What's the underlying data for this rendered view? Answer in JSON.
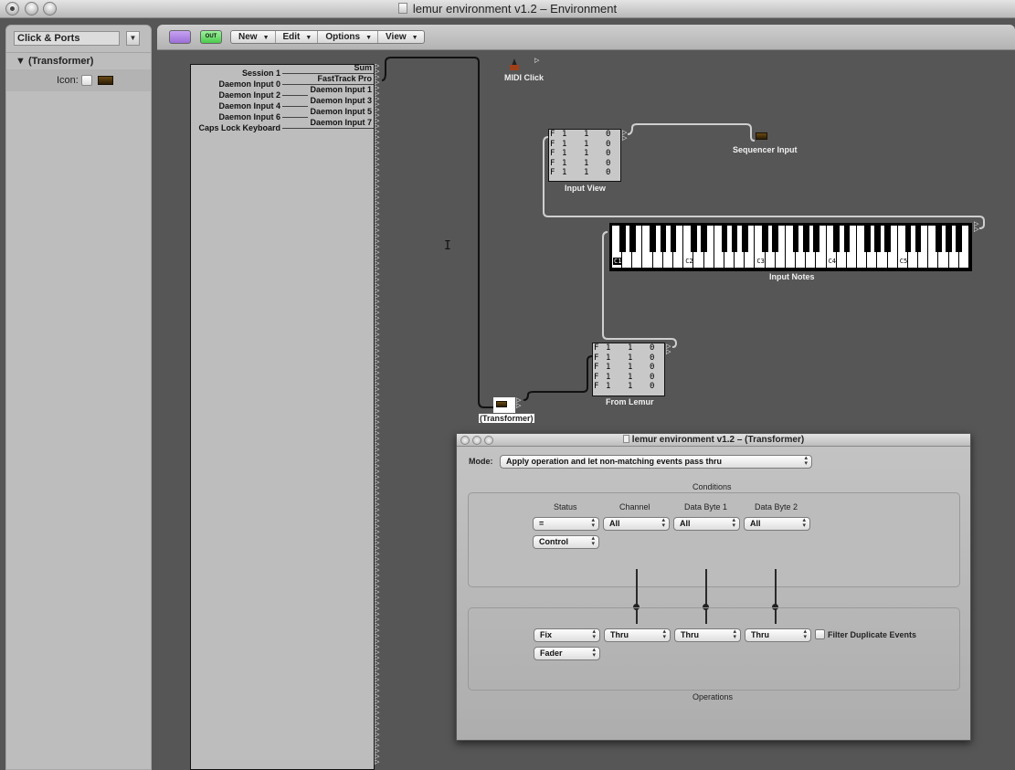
{
  "window": {
    "title": "lemur environment v1.2 – Environment"
  },
  "sidebar": {
    "layer_select": "Click & Ports",
    "inspector_title": "(Transformer)",
    "icon_label": "Icon:"
  },
  "toolbar": {
    "out_label": "OUT",
    "menus": [
      "New",
      "Edit",
      "Options",
      "View"
    ]
  },
  "ports": {
    "left_labels": [
      "Session 1",
      "Daemon Input 0",
      "Daemon Input 2",
      "Daemon Input 4",
      "Daemon Input 6",
      "Caps Lock Keyboard"
    ],
    "right_labels": [
      "Sum",
      "FastTrack Pro",
      "Daemon Input 1",
      "Daemon Input 3",
      "Daemon Input 5",
      "Daemon Input 7"
    ]
  },
  "objects": {
    "midi_click": "MIDI Click",
    "sequencer_input": "Sequencer Input",
    "input_view": {
      "label": "Input View",
      "rows": [
        [
          "F",
          "1",
          "1",
          "0"
        ],
        [
          "F",
          "1",
          "1",
          "0"
        ],
        [
          "F",
          "1",
          "1",
          "0"
        ],
        [
          "F",
          "1",
          "1",
          "0"
        ],
        [
          "F",
          "1",
          "1",
          "0"
        ]
      ]
    },
    "input_notes": {
      "label": "Input Notes",
      "octave_labels": [
        "C1",
        "C2",
        "C3",
        "C4",
        "C5"
      ],
      "highlighted": "C1"
    },
    "from_lemur": {
      "label": "From Lemur",
      "rows": [
        [
          "F",
          "1",
          "1",
          "0"
        ],
        [
          "F",
          "1",
          "1",
          "0"
        ],
        [
          "F",
          "1",
          "1",
          "0"
        ],
        [
          "F",
          "1",
          "1",
          "0"
        ],
        [
          "F",
          "1",
          "1",
          "0"
        ]
      ]
    },
    "transformer": "(Transformer)"
  },
  "transformer_window": {
    "title": "lemur environment v1.2 – (Transformer)",
    "mode_label": "Mode:",
    "mode_value": "Apply operation and let non-matching events pass thru",
    "conditions_title": "Conditions",
    "condition_headers": [
      "Status",
      "Channel",
      "Data Byte 1",
      "Data Byte 2"
    ],
    "condition_values": [
      "=",
      "All",
      "All",
      "All"
    ],
    "status_type": "Control",
    "operation_values": [
      "Fix",
      "Thru",
      "Thru",
      "Thru"
    ],
    "operation_type": "Fader",
    "filter_duplicates_label": "Filter Duplicate Events",
    "filter_duplicates_checked": false,
    "operations_title": "Operations"
  }
}
